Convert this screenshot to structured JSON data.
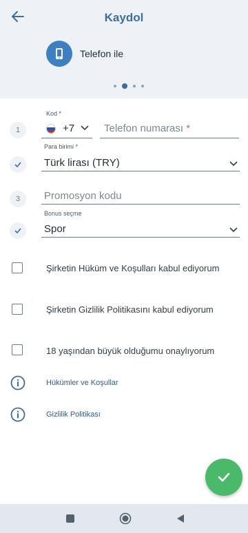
{
  "header": {
    "title": "Kaydol",
    "method_label": "Telefon ile",
    "method_icon": "phone-icon",
    "back_icon": "arrow-left-icon"
  },
  "form": {
    "phone": {
      "step": "1",
      "code_label": "Kod *",
      "code_value": "+7",
      "placeholder": "Telefon numarası *"
    },
    "currency": {
      "label": "Para birimi *",
      "value": "Türk lirası (TRY)"
    },
    "promo": {
      "step": "3",
      "placeholder": "Promosyon kodu"
    },
    "bonus": {
      "label": "Bonus seçme",
      "value": "Spor"
    }
  },
  "checkboxes": [
    {
      "label": "Şirketin Hüküm ve Koşulları kabul ediyorum"
    },
    {
      "label": "Şirketin Gizlilik Politikasını kabul ediyorum"
    },
    {
      "label": "18 yaşından büyük olduğumu onaylıyorum"
    }
  ],
  "links": [
    {
      "label": "Hükümler ve Koşullar"
    },
    {
      "label": "Gizlilik Politikası"
    }
  ],
  "colors": {
    "accent": "#3d6d9a",
    "fab": "#4aba6a",
    "header_bg": "#eef2f7"
  }
}
